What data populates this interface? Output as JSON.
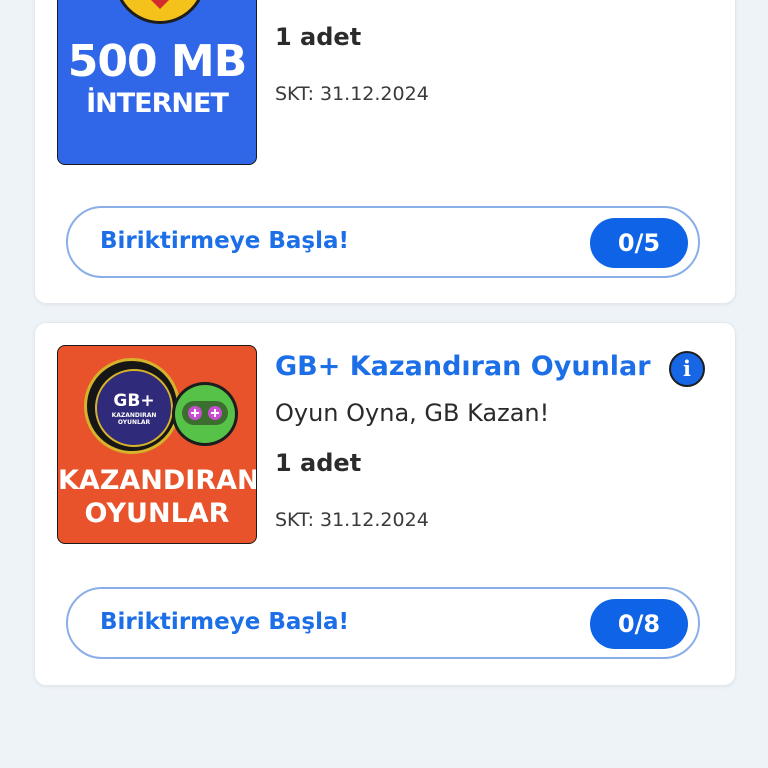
{
  "offers": [
    {
      "image": {
        "big_text": "500 MB",
        "small_text": "İNTERNET",
        "icon": "wifi-heart-icon",
        "background": "#2f67e8"
      },
      "count": "1 adet",
      "expiry": "SKT: 31.12.2024",
      "button_label": "Biriktirmeye Başla!",
      "progress": "0/5"
    },
    {
      "image": {
        "logo_text": "GB+",
        "logo_subtext": "KAZANDIRAN OYUNLAR",
        "big_text_line1": "KAZANDIRAN",
        "big_text_line2": "OYUNLAR",
        "icon": "gamepad-icon",
        "background": "#e8532b"
      },
      "title": "GB+ Kazandıran Oyunlar",
      "subtitle": "Oyun Oyna, GB Kazan!",
      "count": "1 adet",
      "expiry": "SKT: 31.12.2024",
      "button_label": "Biriktirmeye Başla!",
      "progress": "0/8"
    }
  ],
  "colors": {
    "accent": "#1d6fe8",
    "pill": "#0f63e6",
    "page_background": "#eef3f8"
  }
}
